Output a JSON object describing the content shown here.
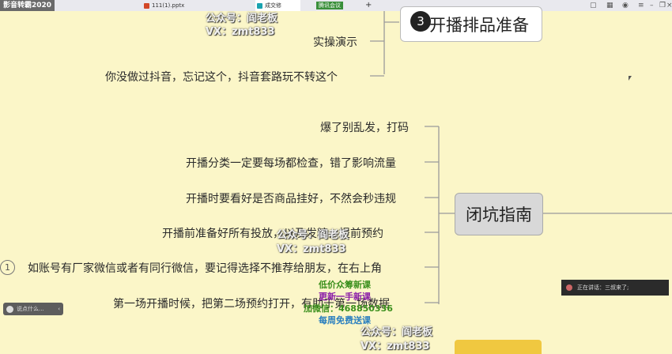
{
  "app": {
    "title": "影音转霸2020"
  },
  "tabs": [
    {
      "label": "111(1).pptx"
    },
    {
      "label": "成交修"
    },
    {
      "label": "腾讯会议"
    }
  ],
  "new_tab": "+",
  "watermarks": {
    "gzh": "公众号：阎老板",
    "vx": "VX：zmt833"
  },
  "mindmap": {
    "prep_node": {
      "number": "3",
      "label": "开播排品准备"
    },
    "prep_children": [
      "实操演示",
      "你没做过抖音，忘记这个，抖音套路玩不转这个"
    ],
    "guide_node": {
      "label": "闭坑指南"
    },
    "guide_children": [
      "爆了别乱发，打码",
      "开播分类一定要每场都检查，错了影响流量",
      "开播时要看好是否商品挂好，不然会秒违规",
      "开播前准备好所有投放，以及发糖，提前预约",
      "如账号有厂家微信或者有同行微信，要记得选择不推荐给朋友，在右上角",
      "第一场开播时候，把第二场预约打开，有助于第一场数据"
    ],
    "circle_marker": "1"
  },
  "promo": [
    {
      "text": "低价众筹新课",
      "color": "#3a8f1c"
    },
    {
      "text": "更新一手新课",
      "color": "#8a1ca8"
    },
    {
      "text": "加微信：468850336",
      "color": "#3a8f1c"
    },
    {
      "text": "每周免费送课",
      "color": "#2a7fbf"
    }
  ],
  "chat": {
    "placeholder": "说点什么...",
    "collapse": "‹"
  },
  "speaking": {
    "text": "正在讲话：三叔来了;"
  }
}
